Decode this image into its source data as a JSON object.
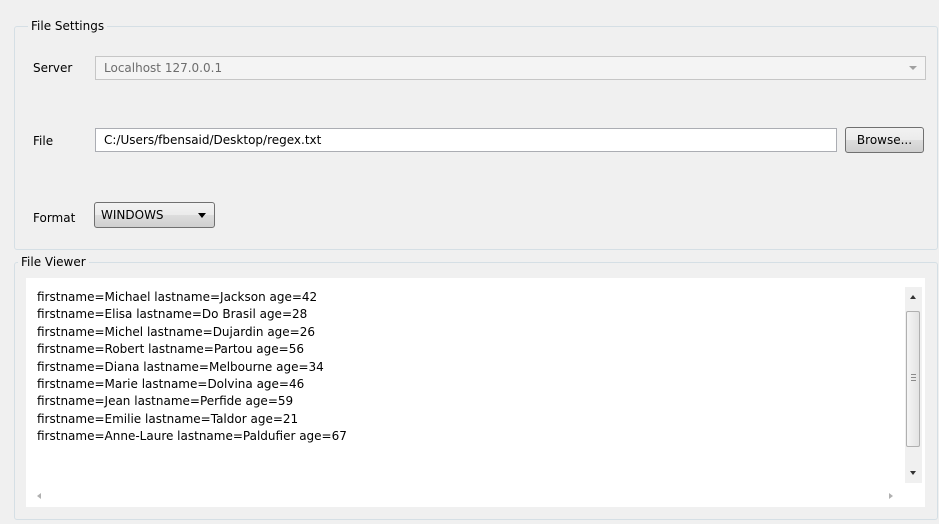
{
  "file_settings": {
    "title": "File Settings",
    "server_label": "Server",
    "server_value": "Localhost 127.0.0.1",
    "file_label": "File",
    "file_value": "C:/Users/fbensaid/Desktop/regex.txt",
    "browse_label": "Browse...",
    "format_label": "Format",
    "format_value": "WINDOWS"
  },
  "file_viewer": {
    "title": "File Viewer",
    "lines": [
      "firstname=Michael lastname=Jackson age=42",
      "firstname=Elisa lastname=Do Brasil age=28",
      "firstname=Michel lastname=Dujardin age=26",
      "firstname=Robert lastname=Partou age=56",
      "firstname=Diana lastname=Melbourne age=34",
      "firstname=Marie lastname=Dolvina age=46",
      "firstname=Jean lastname=Perfide age=59",
      "firstname=Emilie lastname=Taldor age=21",
      "firstname=Anne-Laure lastname=Paldufier age=67"
    ]
  }
}
